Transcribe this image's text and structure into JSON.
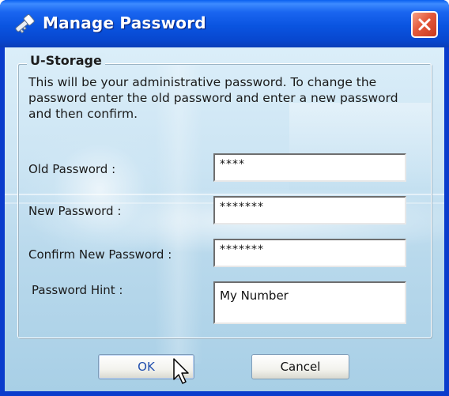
{
  "window": {
    "title": "Manage Password"
  },
  "group": {
    "label": "U-Storage",
    "description": "This will be your administrative password. To change the password enter the old password and enter a new password and then confirm."
  },
  "fields": {
    "old_password": {
      "label": "Old Password :",
      "value": "****"
    },
    "new_password": {
      "label": "New Password :",
      "value": "*******"
    },
    "confirm_password": {
      "label": "Confirm New Password :",
      "value": "*******"
    },
    "password_hint": {
      "label": "Password Hint :",
      "value": "My Number"
    }
  },
  "buttons": {
    "ok_label": "OK",
    "cancel_label": "Cancel"
  },
  "icons": {
    "title": "key-icon",
    "close": "close-icon",
    "cursor": "mouse-pointer-icon"
  },
  "colors": {
    "titlebar": "#0a54e0",
    "close_button": "#e4583a",
    "ok_text": "#214fae"
  }
}
